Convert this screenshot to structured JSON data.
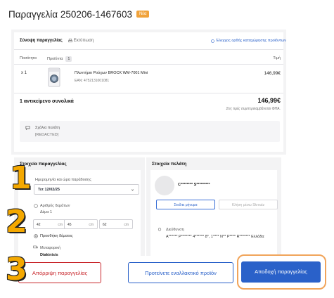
{
  "order": {
    "title": "Παραγγελία 250206-1467603",
    "badge": "Νέα"
  },
  "summary": {
    "tab_active": "Σύνοψη παραγγελίας",
    "tab_print": "Εκτύπωση",
    "check_link": "Έλεγχος ορθής καταχώρησης προϊόντων",
    "col_qty": "Ποσότητα",
    "col_products": "Προϊόντα",
    "product_count": "1",
    "col_price": "Τιμή",
    "item": {
      "qty": "x 1",
      "name": "Πλυντήριο Ρούχων BROCK WM-7001 Mini",
      "ean": "EAN: 4752131001081",
      "price": "146,99€"
    },
    "total_label": "1 αντικείμενο συνολικά",
    "total_value": "146,99€",
    "vat_note": "Στις τιμές συμπεριλαμβάνεται ΦΠΑ.",
    "comments_label": "Σχόλια πελάτη",
    "comments_value": "[REDACTED]"
  },
  "order_details": {
    "title": "Στοιχεία παραγγελίας",
    "date_label": "Ημερομηνία και ώρα παράδοσης",
    "date_value": "Τετ 12/02/25",
    "packages_label": "Αριθμός δεμάτων",
    "package_1": "Δέμα 1",
    "dim_1": "42",
    "dim_2": "45",
    "dim_3": "62",
    "unit": "cm",
    "add_package": "Προσθήκη δέματος",
    "shipping_label": "Μεταφορική",
    "shipping_value": "Diakinisis"
  },
  "customer": {
    "title": "Στοιχεία πελάτη",
    "name": "C******** S*********",
    "send_msg": "Στείλτε μήνυμα",
    "call": "Κλήση μέσω Skroutz",
    "address_label": "Διεύθυνση",
    "address_value": "A****** P******* 4****** 8*, 1**** N** P**** R******* Ελλάδα"
  },
  "markers": {
    "m1": "1",
    "m2": "2",
    "m3": "3"
  },
  "actions": {
    "reject": "Απόρριψη παραγγελίας",
    "alternative": "Προτείνετε εναλλακτικό προϊόν",
    "accept": "Αποδοχή παραγγελίας"
  },
  "colors": {
    "accent_blue": "#2a61c9",
    "reject_red": "#c8262b",
    "highlight_orange": "#f1a45a",
    "badge_orange": "#f0a23a",
    "marker_yellow": "#f4a800"
  }
}
